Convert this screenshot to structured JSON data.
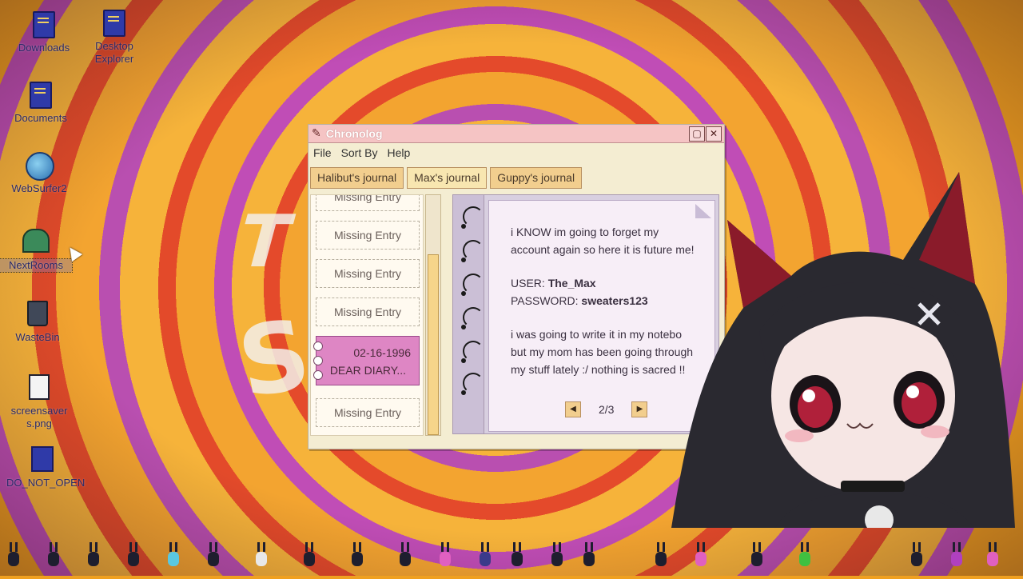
{
  "desktop": {
    "icons": [
      {
        "label": "Downloads",
        "icon": "folder-icon"
      },
      {
        "label": "Desktop Explorer",
        "icon": "folder-icon"
      },
      {
        "label": "Documents",
        "icon": "folder-icon"
      },
      {
        "label": "WebSurfer2",
        "icon": "globe-icon"
      },
      {
        "label": "NextRooms",
        "icon": "house-icon"
      },
      {
        "label": "WasteBin",
        "icon": "trash-icon"
      },
      {
        "label": "screensaver s.png",
        "icon": "image-file-icon"
      },
      {
        "label": "DO_NOT_OPEN",
        "icon": "zip-folder-icon"
      }
    ]
  },
  "window": {
    "title": "Chronolog",
    "menu": [
      "File",
      "Sort By",
      "Help"
    ],
    "tabs": [
      "Halibut's journal",
      "Max's journal",
      "Guppy's journal"
    ],
    "active_tab": "Max's journal",
    "entries": [
      {
        "label": "Missing Entry"
      },
      {
        "label": "Missing Entry"
      },
      {
        "label": "Missing Entry"
      },
      {
        "label": "Missing Entry"
      },
      {
        "date": "02-16-1996",
        "title": "DEAR DIARY..."
      },
      {
        "label": "Missing Entry"
      }
    ],
    "note": {
      "line1": "i KNOW im going to forget my",
      "line2": "account again so here it is future me!",
      "user_label": "USER:",
      "user_value": "The_Max",
      "password_label": "PASSWORD:",
      "password_value": "sweaters123",
      "line5": "i was going to write it in my notebo",
      "line6": "but my mom has been going through",
      "line7": "my stuff lately :/ nothing is sacred !!"
    },
    "pager": {
      "label": "2/3"
    }
  },
  "colors": {
    "title_bar": "#f5c4c4",
    "selected_entry": "#de86c4",
    "tab": "#f2ce8e",
    "window_bg": "#f4edd2"
  }
}
